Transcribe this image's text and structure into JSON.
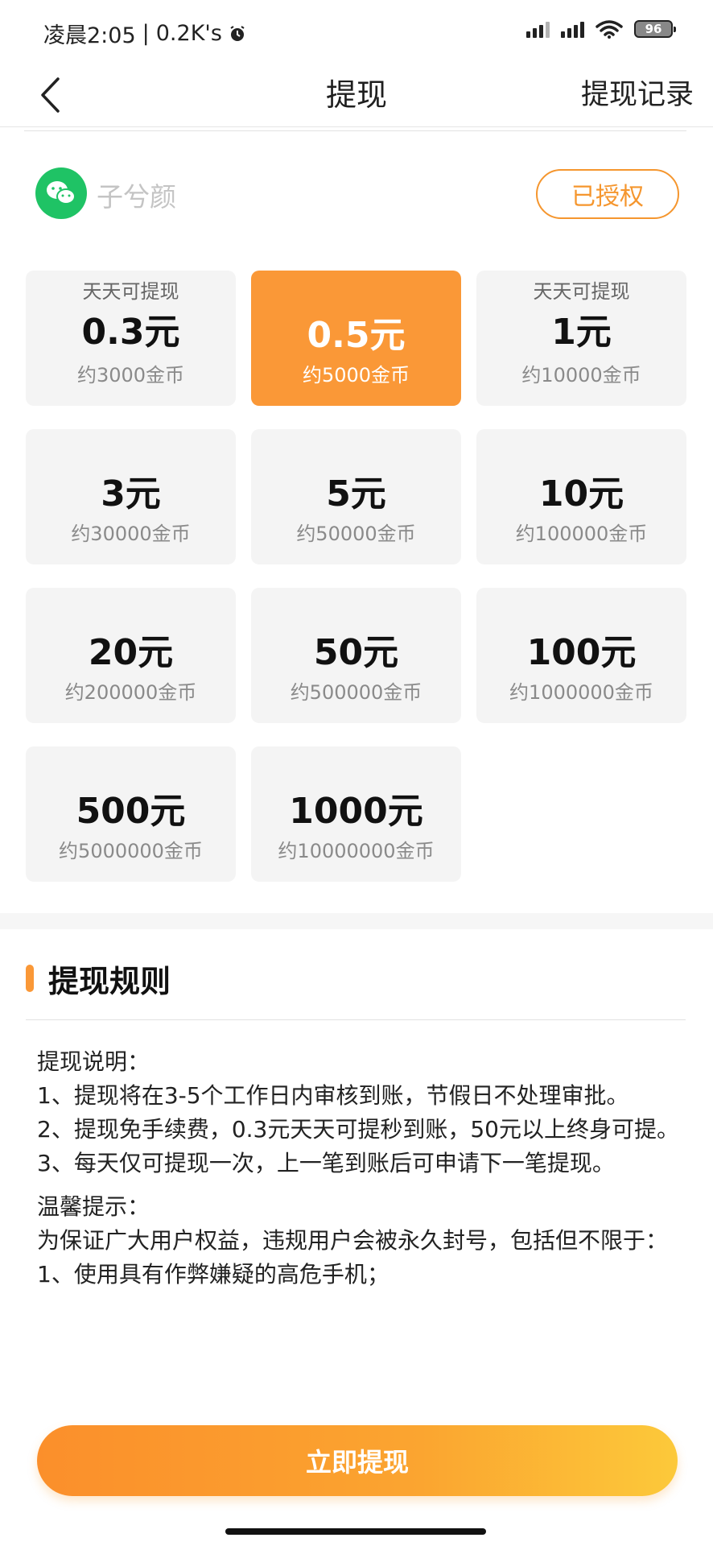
{
  "status_bar": {
    "time": "凌晨2:05",
    "separator": "|",
    "speed": "0.2K's",
    "battery": "96"
  },
  "header": {
    "title": "提现",
    "records_label": "提现记录"
  },
  "account": {
    "name": "子兮颜",
    "auth_label": "已授权"
  },
  "amounts": [
    {
      "tag": "天天可提现",
      "amount": "0.3元",
      "coins": "约3000金币",
      "selected": false
    },
    {
      "tag": "",
      "amount": "0.5元",
      "coins": "约5000金币",
      "selected": true
    },
    {
      "tag": "天天可提现",
      "amount": "1元",
      "coins": "约10000金币",
      "selected": false
    },
    {
      "tag": "",
      "amount": "3元",
      "coins": "约30000金币",
      "selected": false
    },
    {
      "tag": "",
      "amount": "5元",
      "coins": "约50000金币",
      "selected": false
    },
    {
      "tag": "",
      "amount": "10元",
      "coins": "约100000金币",
      "selected": false
    },
    {
      "tag": "",
      "amount": "20元",
      "coins": "约200000金币",
      "selected": false
    },
    {
      "tag": "",
      "amount": "50元",
      "coins": "约500000金币",
      "selected": false
    },
    {
      "tag": "",
      "amount": "100元",
      "coins": "约1000000金币",
      "selected": false
    },
    {
      "tag": "",
      "amount": "500元",
      "coins": "约5000000金币",
      "selected": false
    },
    {
      "tag": "",
      "amount": "1000元",
      "coins": "约10000000金币",
      "selected": false
    }
  ],
  "rules": {
    "title": "提现规则",
    "section1_title": "提现说明：",
    "section1_items": [
      "1、提现将在3-5个工作日内审核到账，节假日不处理审批。",
      "2、提现免手续费，0.3元天天可提秒到账，50元以上终身可提。",
      "3、每天仅可提现一次，上一笔到账后可申请下一笔提现。"
    ],
    "section2_title": "温馨提示：",
    "section2_intro": "为保证广大用户权益，违规用户会被永久封号，包括但不限于：",
    "section2_items": [
      "1、使用具有作弊嫌疑的高危手机；"
    ]
  },
  "cta": {
    "label": "立即提现"
  },
  "colors": {
    "accent": "#fa9837",
    "wechat": "#1fc365",
    "card_bg": "#f4f4f4"
  }
}
